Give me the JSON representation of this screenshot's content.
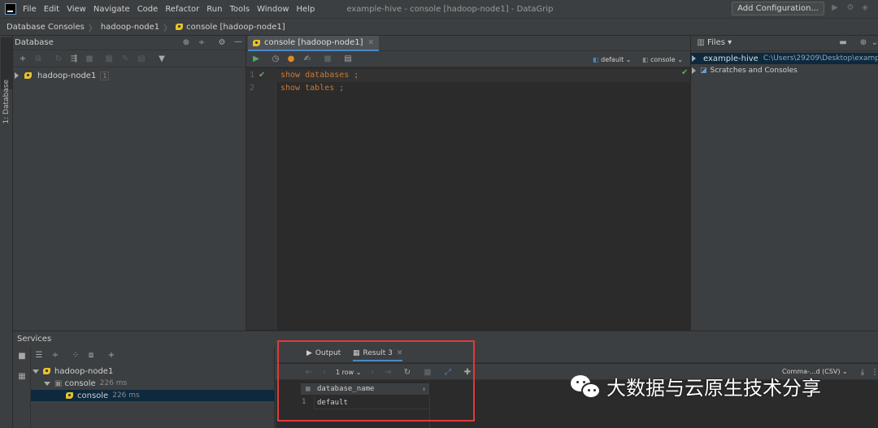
{
  "menubar": {
    "items": [
      "File",
      "Edit",
      "View",
      "Navigate",
      "Code",
      "Refactor",
      "Run",
      "Tools",
      "Window",
      "Help"
    ],
    "window_title": "example-hive - console [hadoop-node1] - DataGrip"
  },
  "navbar": {
    "crumb_1": "Database Consoles",
    "crumb_2": "hadoop-node1",
    "crumb_3": "console [hadoop-node1]",
    "add_configuration": "Add Configuration..."
  },
  "left_strip": {
    "tool_label": "1: Database"
  },
  "database_panel": {
    "title": "Database",
    "tree": [
      {
        "label": "hadoop-node1",
        "count": "1"
      }
    ]
  },
  "editor": {
    "tab_label": "console [hadoop-node1]",
    "schema": "default",
    "console": "console",
    "lines": [
      {
        "no": "1",
        "text": "show databases ;"
      },
      {
        "no": "2",
        "text": "show tables ;"
      }
    ]
  },
  "files_panel": {
    "title": "Files",
    "items": [
      {
        "label": "example-hive",
        "path": "C:\\Users\\29209\\Desktop\\examp"
      },
      {
        "label": "Scratches and Consoles"
      }
    ]
  },
  "services": {
    "title": "Services",
    "tree": [
      {
        "label": "hadoop-node1"
      },
      {
        "label": "console",
        "time": "226 ms"
      },
      {
        "label": "console",
        "time": "226 ms"
      }
    ]
  },
  "results": {
    "tab_output": "Output",
    "tab_result": "Result 3",
    "row_count": "1 row",
    "export_format": "Comma-...d (CSV)",
    "column": "database_name",
    "rows": [
      {
        "no": "1",
        "value": "default"
      }
    ]
  },
  "watermark": {
    "text": "大数据与云原生技术分享"
  },
  "colors": {
    "keyword": "#cc7832",
    "selection": "#0d293e",
    "accent": "#4a88c7",
    "highlight": "#e03a3a"
  }
}
